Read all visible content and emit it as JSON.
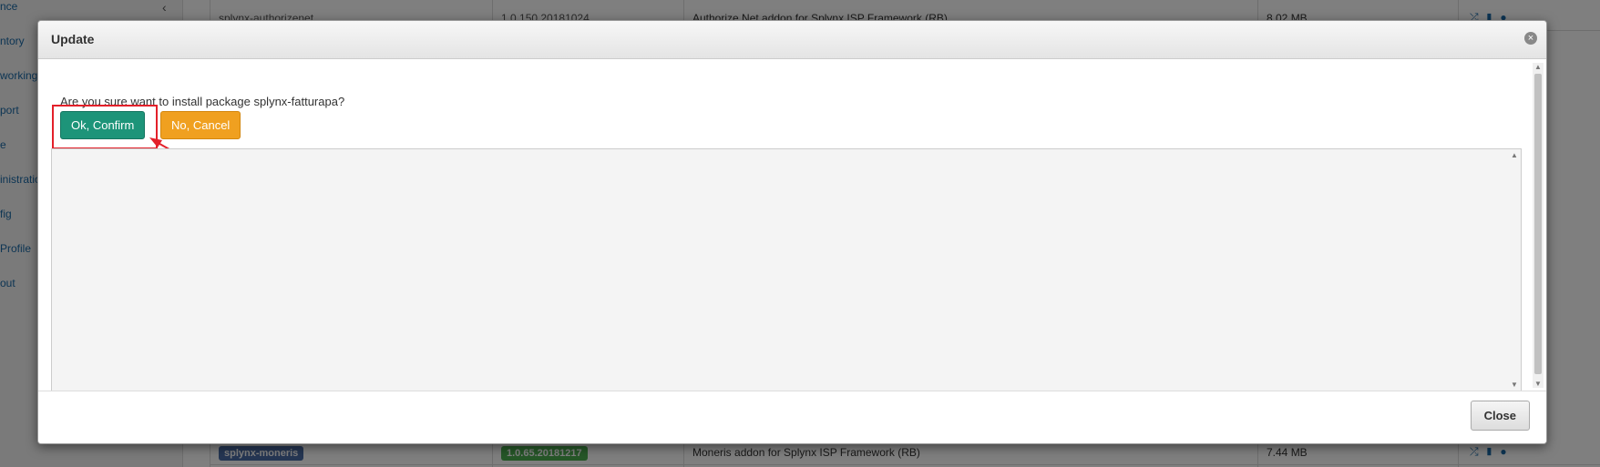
{
  "background": {
    "sidebar_items": [
      "nce",
      "ntory",
      "working",
      "port",
      "e",
      "inistratio",
      "fig",
      "Profile",
      "out"
    ],
    "rows": [
      {
        "name": "splynx-authorizenet",
        "version": "1.0.150.20181024",
        "description": "Authorize.Net addon for Splynx ISP Framework (RB)",
        "size": "8.02 MB"
      },
      {
        "name": "splynx-moneris",
        "version": "1.0.65.20181217",
        "description": "Moneris addon for Splynx ISP Framework (RB)",
        "size": "7.44 MB"
      }
    ]
  },
  "modal": {
    "title": "Update",
    "close_icon": "close-circle-icon",
    "message": "Are you sure want to install package splynx-fatturapa?",
    "confirm_label": "Ok, Confirm",
    "cancel_label": "No, Cancel",
    "footer_close_label": "Close"
  },
  "colors": {
    "confirm": "#1d9479",
    "cancel": "#f0a020",
    "highlight": "#e3202a"
  }
}
